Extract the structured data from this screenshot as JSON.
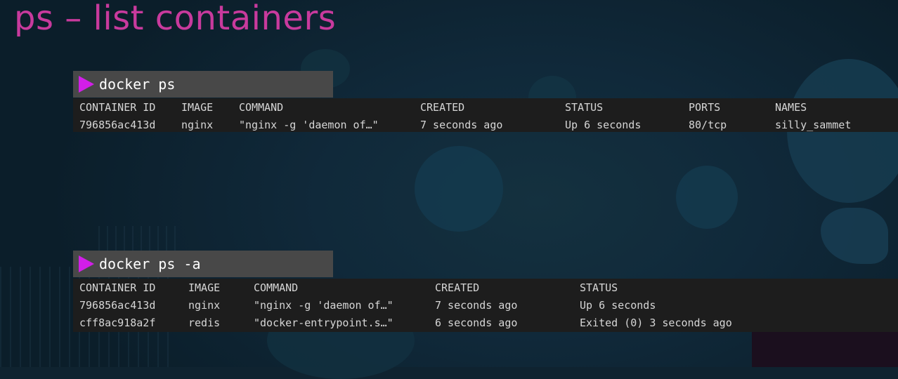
{
  "title": "ps – list containers",
  "colors": {
    "title": "#c83a9d",
    "prompt_icon": "#d21ee8",
    "command_bar": "#484848",
    "output_bg": "#1d1d1d",
    "output_text": "#d6d6d6"
  },
  "blocks": [
    {
      "prompt_icon": "play-triangle-icon",
      "command": "docker ps",
      "headers": [
        "CONTAINER ID",
        "IMAGE",
        "COMMAND",
        "CREATED",
        "STATUS",
        "PORTS",
        "NAMES"
      ],
      "rows": [
        [
          "796856ac413d",
          "nginx",
          "\"nginx -g 'daemon of…\"",
          "7 seconds ago",
          "Up 6 seconds",
          "80/tcp",
          "silly_sammet"
        ]
      ]
    },
    {
      "prompt_icon": "play-triangle-icon",
      "command": "docker ps -a",
      "headers": [
        "CONTAINER ID",
        "IMAGE",
        "COMMAND",
        "CREATED",
        "STATUS"
      ],
      "rows": [
        [
          "796856ac413d",
          "nginx",
          "\"nginx -g 'daemon of…\"",
          "7 seconds ago",
          "Up 6 seconds"
        ],
        [
          "cff8ac918a2f",
          "redis",
          "\"docker-entrypoint.s…\"",
          "6 seconds ago",
          "Exited (0) 3 seconds ago"
        ]
      ]
    }
  ]
}
